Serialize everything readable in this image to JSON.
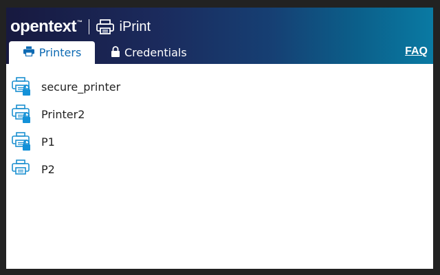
{
  "header": {
    "brand": "opentext",
    "trademark": "™",
    "app_name": "iPrint",
    "app_icon": "printer-icon",
    "faq_label": "FAQ"
  },
  "tabs": [
    {
      "label": "Printers",
      "icon": "printer-icon",
      "active": true
    },
    {
      "label": "Credentials",
      "icon": "lock-icon",
      "active": false
    }
  ],
  "printers": [
    {
      "name": "secure_printer",
      "icon": "secure-printer-icon",
      "secure": true
    },
    {
      "name": "Printer2",
      "icon": "secure-printer-icon",
      "secure": true
    },
    {
      "name": "P1",
      "icon": "secure-printer-icon",
      "secure": true
    },
    {
      "name": "P2",
      "icon": "printer-icon",
      "secure": false
    }
  ],
  "colors": {
    "header_dark": "#17193f",
    "header_light": "#0a7aa3",
    "accent": "#0d6ab3",
    "icon_blue": "#1a8fd0",
    "lock_blue": "#1391d8"
  }
}
